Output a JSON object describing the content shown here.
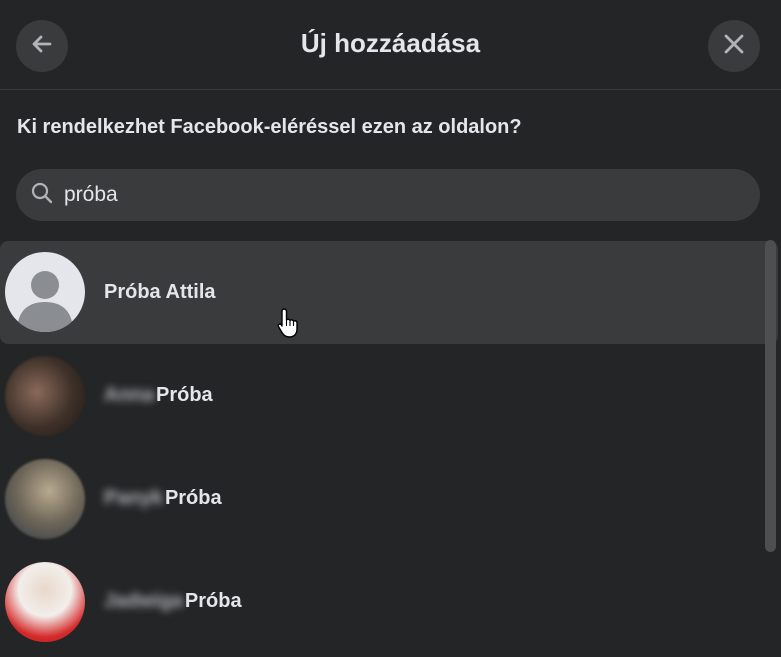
{
  "header": {
    "title": "Új hozzáadása",
    "back_icon": "arrow-left-icon",
    "close_icon": "close-icon"
  },
  "question": "Ki rendelkezhet Facebook-eléréssel ezen az oldalon?",
  "search": {
    "value": "próba",
    "icon": "search-icon"
  },
  "results": [
    {
      "name": "Próba Attila",
      "avatar": "default-avatar",
      "hovered": true
    },
    {
      "first_blurred": "Anna",
      "last": "Próba",
      "avatar": "photo-avatar"
    },
    {
      "first_blurred": "Panyk",
      "last": "Próba",
      "avatar": "photo-avatar"
    },
    {
      "first_blurred": "Jadwiga",
      "last": "Próba",
      "avatar": "photo-avatar"
    }
  ],
  "colors": {
    "background": "#242526",
    "surface": "#3a3b3c",
    "text": "#e4e6eb"
  }
}
